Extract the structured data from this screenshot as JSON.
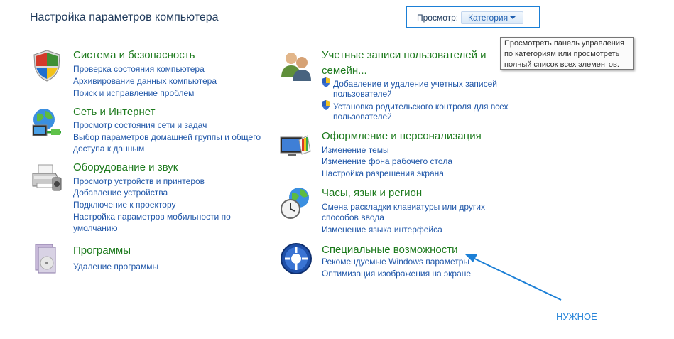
{
  "page_title": "Настройка параметров компьютера",
  "view": {
    "label": "Просмотр:",
    "selected": "Категория"
  },
  "tooltip": {
    "lines": [
      "Просмотреть панель управления",
      "по категориям или просмотреть",
      "полный список всех элементов."
    ]
  },
  "categories": [
    {
      "title": "Система и безопасность",
      "icon": "security-shield-icon",
      "links": [
        "Проверка состояния компьютера",
        "Архивирование данных компьютера",
        "Поиск и исправление проблем"
      ]
    },
    {
      "title": "Сеть и Интернет",
      "icon": "network-globe-icon",
      "links": [
        "Просмотр состояния сети и задач",
        "Выбор параметров домашней группы и общего",
        "доступа к данным"
      ]
    },
    {
      "title": "Оборудование и звук",
      "icon": "printer-icon",
      "links": [
        "Просмотр устройств и принтеров",
        "Добавление устройства",
        "Подключение к проектору",
        "Настройка параметров мобильности по",
        "умолчанию"
      ]
    },
    {
      "title": "Программы",
      "icon": "programs-icon",
      "links": [
        "Удаление программы"
      ]
    },
    {
      "title_lines": [
        "Учетные записи пользователей и",
        "семейн..."
      ],
      "icon": "users-icon",
      "links": [
        "Добавление и удаление учетных записей",
        "пользователей",
        "Установка родительского контроля для всех",
        "пользователей"
      ]
    },
    {
      "title": "Оформление и персонализация",
      "icon": "personalization-monitor-icon",
      "links": [
        "Изменение темы",
        "Изменение фона рабочего стола",
        "Настройка разрешения экрана"
      ]
    },
    {
      "title": "Часы, язык и регион",
      "icon": "clock-globe-icon",
      "links": [
        "Смена раскладки клавиатуры или других",
        "способов ввода",
        "Изменение языка интерфейса"
      ]
    },
    {
      "title": "Специальные возможности",
      "icon": "accessibility-icon",
      "links": [
        "Рекомендуемые Windows параметры",
        "Оптимизация изображения на экране"
      ]
    }
  ],
  "annotation": "НУЖНОЕ",
  "colors": {
    "title_green": "#1d7a1d",
    "link_blue": "#1f56a8",
    "annotation_blue": "#2a86d9"
  }
}
